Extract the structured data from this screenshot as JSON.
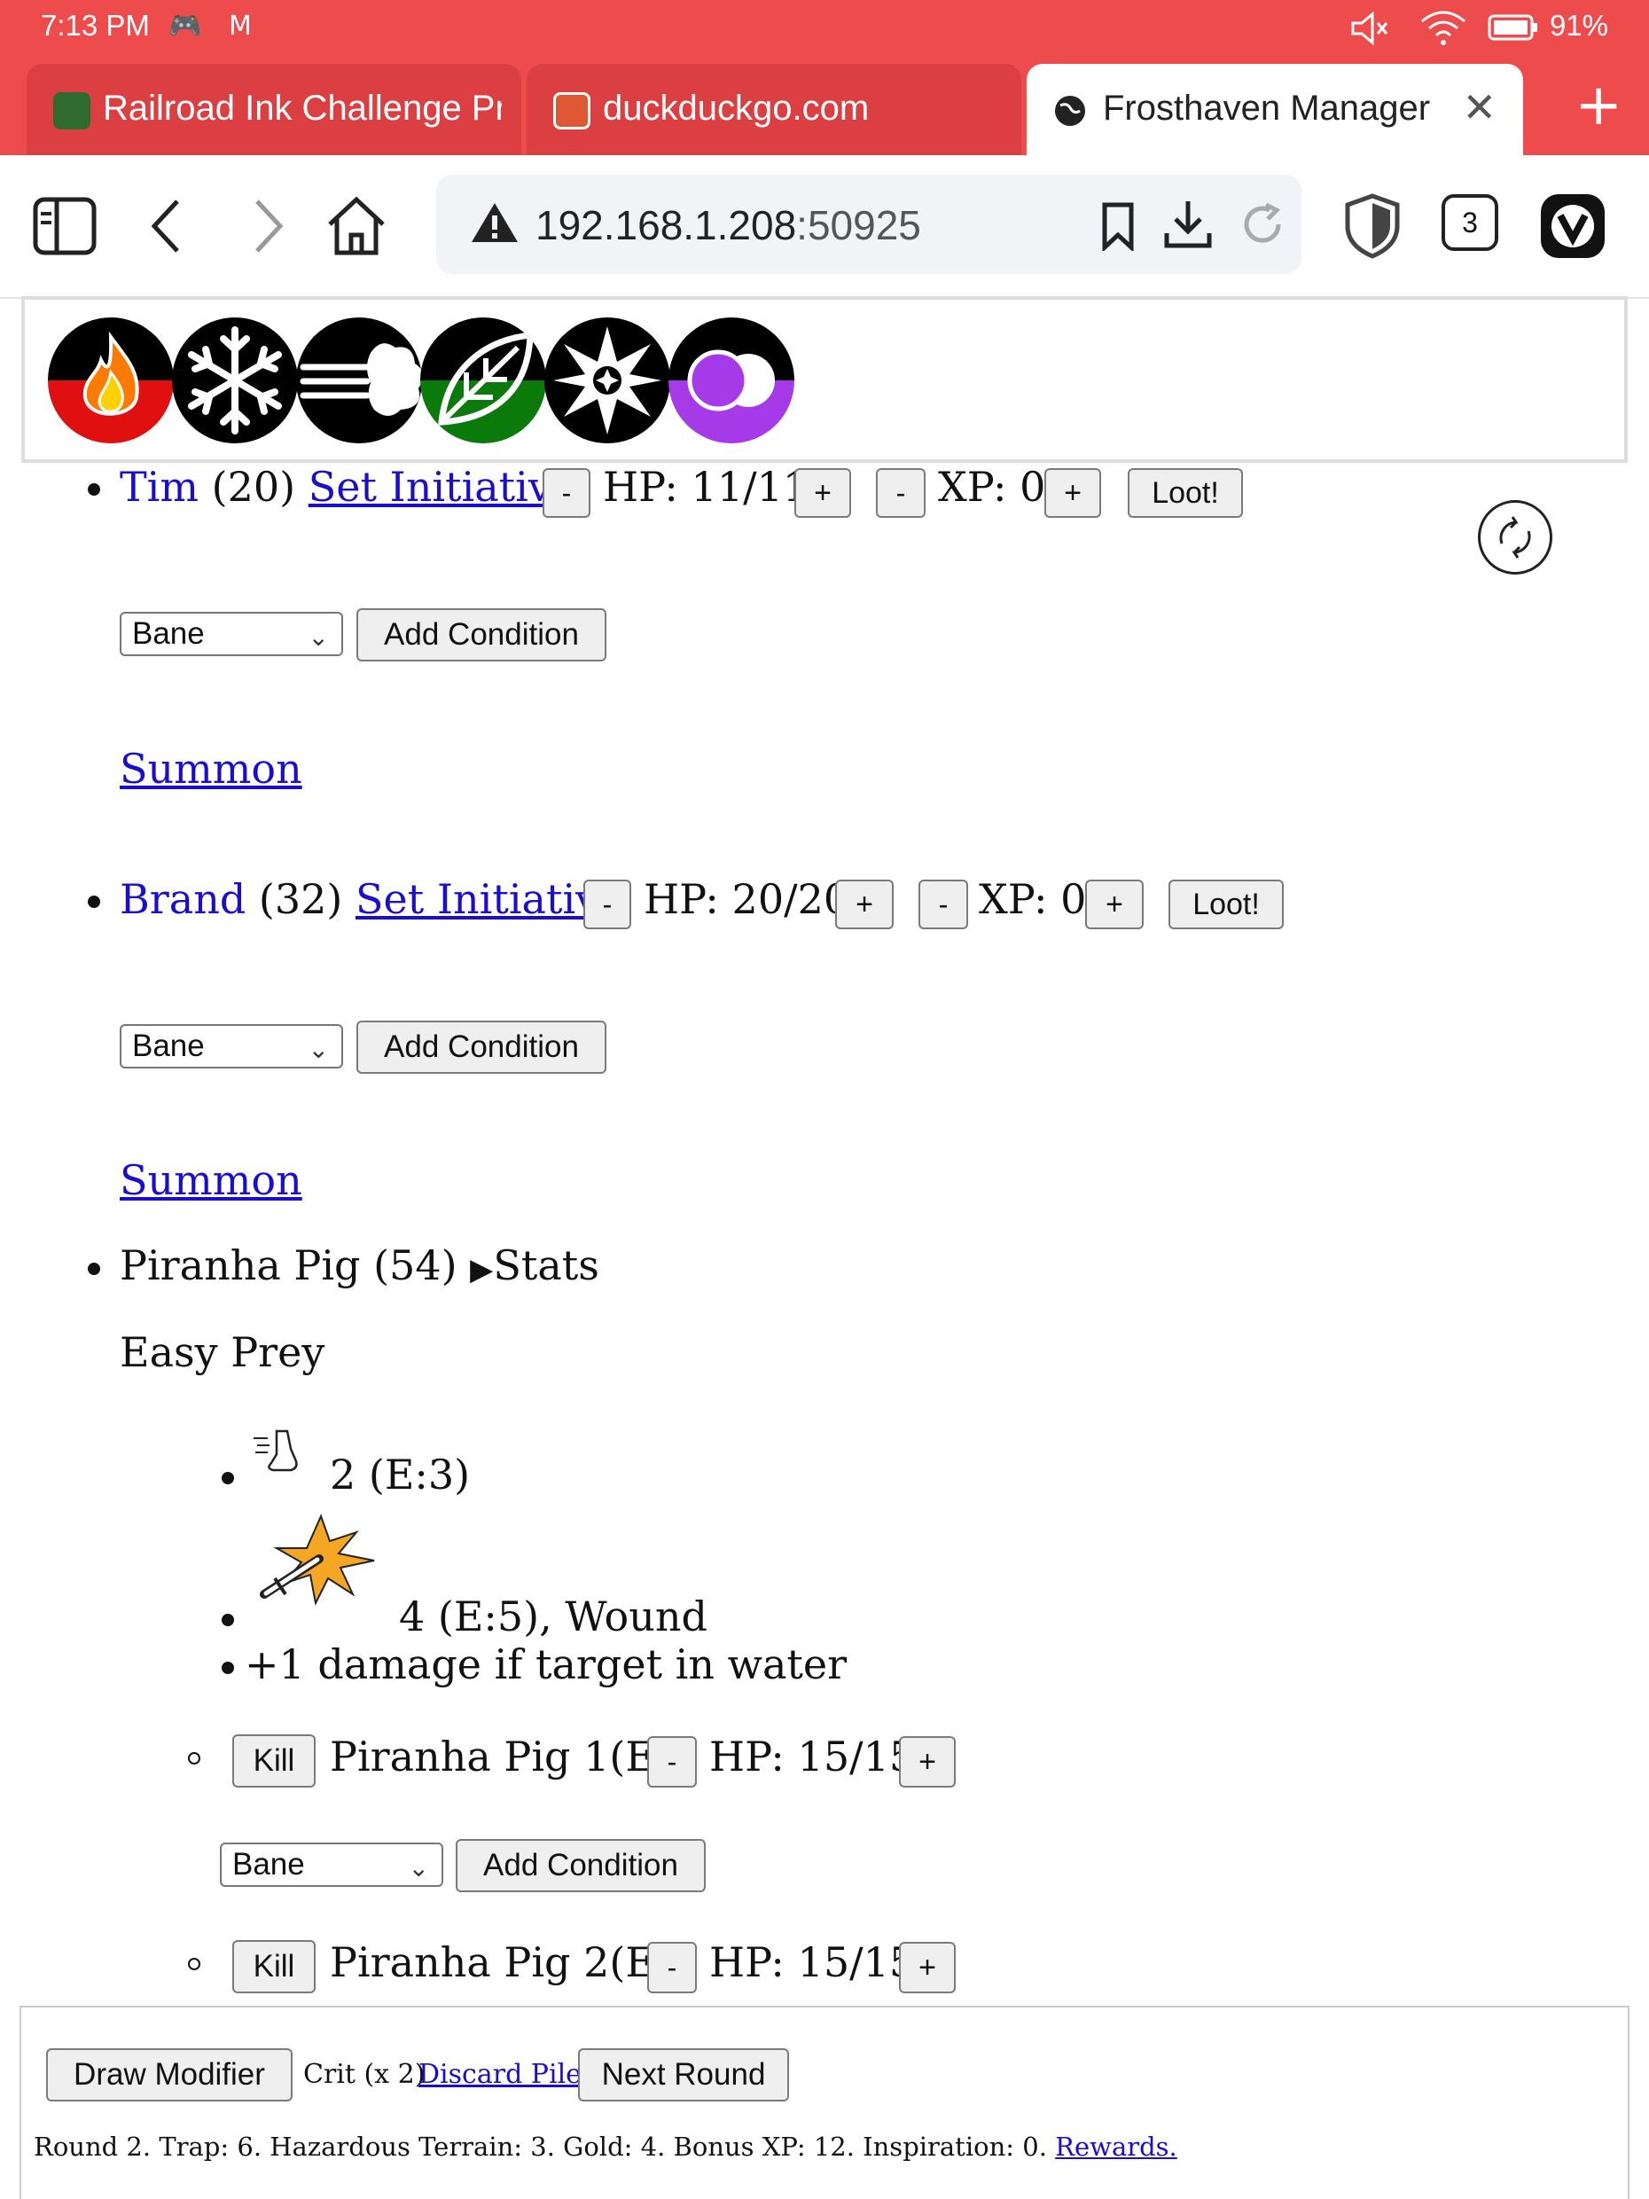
{
  "status_bar": {
    "time": "7:13 PM",
    "battery": "91%"
  },
  "tabs": [
    {
      "label": "Railroad Ink Challenge Pr",
      "active": false
    },
    {
      "label": "duckduckgo.com",
      "active": false
    },
    {
      "label": "Frosthaven Manager",
      "active": true
    }
  ],
  "toolbar": {
    "url_host": "192.168.1.208",
    "url_port": ":50925",
    "tab_count": "3"
  },
  "elements": [
    "fire-icon",
    "ice-icon",
    "air-icon",
    "earth-icon",
    "light-icon",
    "dark-icon"
  ],
  "characters": [
    {
      "name": "Tim",
      "initiative": "(20)",
      "set_initiative": "Set Initiative",
      "minus": "-",
      "hp": "HP: 11/11",
      "plus": "+",
      "xp_minus": "-",
      "xp": "XP: 0",
      "xp_plus": "+",
      "loot": "Loot!",
      "condition": "Bane",
      "add_condition": "Add Condition",
      "summon": "Summon"
    },
    {
      "name": "Brand",
      "initiative": "(32)",
      "set_initiative": "Set Initiative",
      "minus": "-",
      "hp": "HP: 20/20",
      "plus": "+",
      "xp_minus": "-",
      "xp": "XP: 0",
      "xp_plus": "+",
      "loot": "Loot!",
      "condition": "Bane",
      "add_condition": "Add Condition",
      "summon": "Summon"
    }
  ],
  "monster": {
    "title": "Piranha Pig (54)",
    "stats_toggle": "Stats",
    "ability_name": "Easy Prey",
    "actions": [
      {
        "icon": "move-icon",
        "text": "2 (E:3)"
      },
      {
        "icon": "attack-icon",
        "text": "4 (E:5), Wound"
      },
      {
        "icon": "",
        "text": "+1 damage if target in water"
      }
    ],
    "instances": [
      {
        "kill": "Kill",
        "name": "Piranha Pig 1(E)",
        "minus": "-",
        "hp": "HP: 15/15",
        "plus": "+",
        "condition": "Bane",
        "add_condition": "Add Condition"
      },
      {
        "kill": "Kill",
        "name": "Piranha Pig 2(E)",
        "minus": "-",
        "hp": "HP: 15/15",
        "plus": "+"
      }
    ]
  },
  "footer": {
    "draw_modifier": "Draw Modifier",
    "last_modifier": "Crit (x 2)",
    "discard_pile": "Discard Pile",
    "next_round": "Next Round",
    "summary": "Round 2. Trap: 6. Hazardous Terrain: 3. Gold: 4. Bonus XP: 12. Inspiration: 0.",
    "rewards": "Rewards."
  }
}
